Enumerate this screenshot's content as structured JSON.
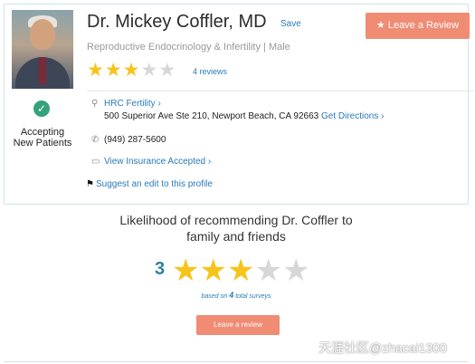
{
  "profile": {
    "name": "Dr. Mickey Coffler, MD",
    "save_label": "Save",
    "leave_review_label": "Leave a Review",
    "specialty": "Reproductive Endocrinology & Infertility | Male",
    "rating_stars": 3,
    "max_stars": 5,
    "reviews_label": "4 reviews",
    "accepting_line1": "Accepting",
    "accepting_line2": "New Patients",
    "practice_name": "HRC Fertility ›",
    "address": "500 Superior Ave Ste 210, Newport Beach, CA 92663",
    "directions_label": "Get Directions ›",
    "phone": "(949) 287-5600",
    "insurance_label": "View Insurance Accepted ›",
    "suggest_edit_label": "Suggest an edit to this profile"
  },
  "recommend": {
    "title_line1": "Likelihood of recommending Dr. Coffler to",
    "title_line2": "family and friends",
    "rating": "3",
    "based_prefix": "based on",
    "based_count": "4",
    "based_suffix": "total surveys",
    "button_label": "Leave a review"
  },
  "watermark": "天涯社区@zhacai1300",
  "colors": {
    "star_on": "#f7c41b",
    "star_off": "#d7d7d7",
    "accent_button": "#f08b74",
    "link": "#2a7ab7",
    "accept_green": "#35a27c"
  }
}
